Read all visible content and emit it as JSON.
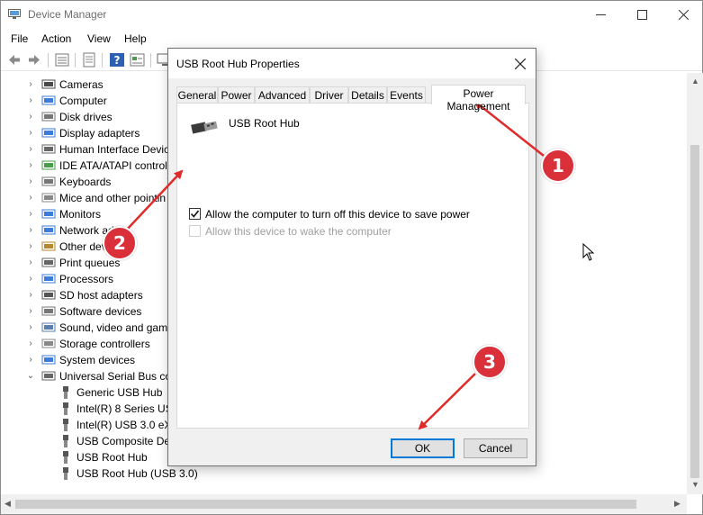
{
  "window": {
    "title": "Device Manager",
    "caption_buttons": [
      "minimize-icon",
      "maximize-icon",
      "close-icon"
    ]
  },
  "menu": [
    "File",
    "Action",
    "View",
    "Help"
  ],
  "toolbar_icons": [
    "back-icon",
    "forward-icon",
    "properties-icon",
    "update-icon",
    "help-icon",
    "scan-icon",
    "monitor-icon"
  ],
  "tree": {
    "categories": [
      {
        "label": "Cameras",
        "icon": "camera-icon"
      },
      {
        "label": "Computer",
        "icon": "computer-icon"
      },
      {
        "label": "Disk drives",
        "icon": "disk-icon"
      },
      {
        "label": "Display adapters",
        "icon": "display-adapter-icon"
      },
      {
        "label": "Human Interface Devic",
        "icon": "hid-icon"
      },
      {
        "label": "IDE ATA/ATAPI controlle",
        "icon": "ide-icon"
      },
      {
        "label": "Keyboards",
        "icon": "keyboard-icon"
      },
      {
        "label": "Mice and other pointin",
        "icon": "mouse-icon"
      },
      {
        "label": "Monitors",
        "icon": "monitor-icon"
      },
      {
        "label": "Network ad",
        "icon": "network-icon"
      },
      {
        "label": "Other dev",
        "icon": "other-device-icon"
      },
      {
        "label": "Print queues",
        "icon": "printer-icon"
      },
      {
        "label": "Processors",
        "icon": "cpu-icon"
      },
      {
        "label": "SD host adapters",
        "icon": "sd-icon"
      },
      {
        "label": "Software devices",
        "icon": "software-icon"
      },
      {
        "label": "Sound, video and game",
        "icon": "sound-icon"
      },
      {
        "label": "Storage controllers",
        "icon": "storage-icon"
      },
      {
        "label": "System devices",
        "icon": "system-icon"
      },
      {
        "label": "Universal Serial Bus con",
        "icon": "usb-controller-icon"
      }
    ],
    "usb_children": [
      "Generic USB Hub",
      "Intel(R) 8 Series USB",
      "Intel(R) USB 3.0 eXte",
      "USB Composite Devi",
      "USB Root Hub",
      "USB Root Hub (USB 3.0)"
    ]
  },
  "dialog": {
    "title": "USB Root Hub Properties",
    "tabs": [
      "General",
      "Power",
      "Advanced",
      "Driver",
      "Details",
      "Events",
      "Power Management"
    ],
    "active_tab": "Power Management",
    "device_name": "USB Root Hub",
    "options": [
      {
        "label": "Allow the computer to turn off this device to save power",
        "checked": true,
        "enabled": true
      },
      {
        "label": "Allow this device to wake the computer",
        "checked": false,
        "enabled": false
      }
    ],
    "ok_label": "OK",
    "cancel_label": "Cancel"
  },
  "annotations": {
    "badges": [
      "1",
      "2",
      "3"
    ],
    "color": "#d9303a"
  }
}
